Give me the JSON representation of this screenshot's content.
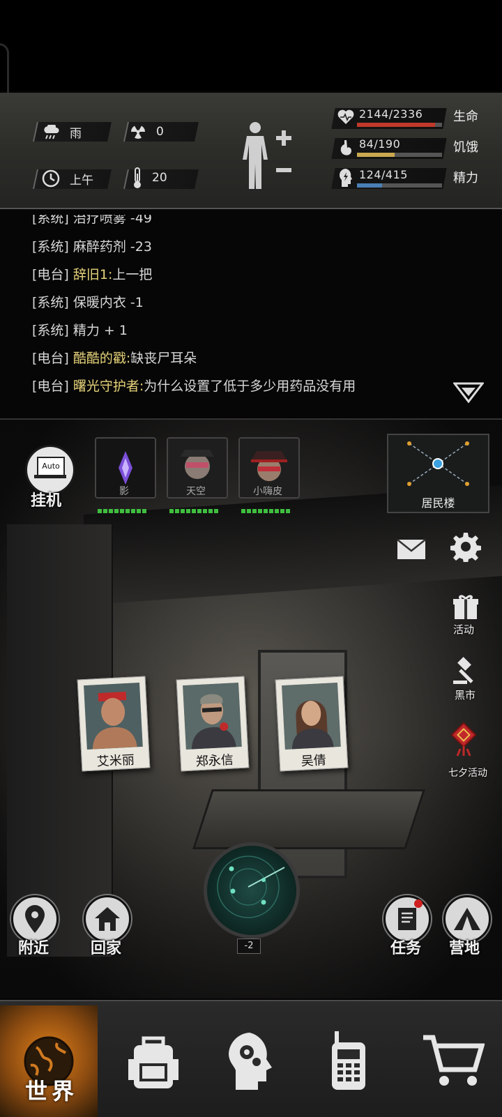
{
  "stats": {
    "weather": "雨",
    "radiation": "0",
    "time_of_day": "上午",
    "temperature": "20",
    "health": {
      "label": "生命",
      "text": "2144/2336",
      "fraction": 0.918,
      "color": "#c0392b"
    },
    "hunger": {
      "label": "饥饿",
      "text": "84/190",
      "fraction": 0.442,
      "color": "#c9a850"
    },
    "energy": {
      "label": "精力",
      "text": "124/415",
      "fraction": 0.299,
      "color": "#4a7fb5"
    }
  },
  "log": [
    {
      "tag": "[系统]",
      "text": "治疗喷雾 -49",
      "type": "sys"
    },
    {
      "tag": "[系统]",
      "text": "麻醉药剂 -23",
      "type": "sys"
    },
    {
      "tag": "[电台]",
      "speaker": "辞旧1:",
      "text": "上一把",
      "type": "radio"
    },
    {
      "tag": "[系统]",
      "text": "保暖内衣 -1",
      "type": "sys"
    },
    {
      "tag": "[系统]",
      "text": "精力 + 1",
      "type": "sys"
    },
    {
      "tag": "[电台]",
      "speaker": "酷酷的戳:",
      "text": "缺丧尸耳朵",
      "type": "radio"
    },
    {
      "tag": "[电台]",
      "speaker": "曙光守护者:",
      "text": "为什么设置了低于多少用药品没有用",
      "type": "radio"
    }
  ],
  "auto": {
    "badge": "Auto",
    "label": "挂机"
  },
  "companions": [
    {
      "name": "影"
    },
    {
      "name": "天空"
    },
    {
      "name": "小嗨皮"
    }
  ],
  "location": {
    "label": "居民楼"
  },
  "side_buttons": {
    "activity": "活动",
    "black_market": "黑市",
    "qixi": "七夕活动"
  },
  "npcs": [
    {
      "name": "艾米丽"
    },
    {
      "name": "郑永信"
    },
    {
      "name": "吴倩"
    }
  ],
  "radar": {
    "level": "-2"
  },
  "bottom_buttons": {
    "nearby": "附近",
    "home": "回家",
    "tasks": "任务",
    "camp": "营地"
  },
  "nav": {
    "world": "世界",
    "icons": [
      "globe-icon",
      "backpack-icon",
      "head-gears-icon",
      "radio-icon",
      "cart-icon"
    ]
  },
  "colors": {
    "radio_text": "#e6d27a",
    "health_bar": "#c0392b",
    "hunger_bar": "#c9a850",
    "energy_bar": "#4a7fb5",
    "nav_active": "#e0801a"
  }
}
